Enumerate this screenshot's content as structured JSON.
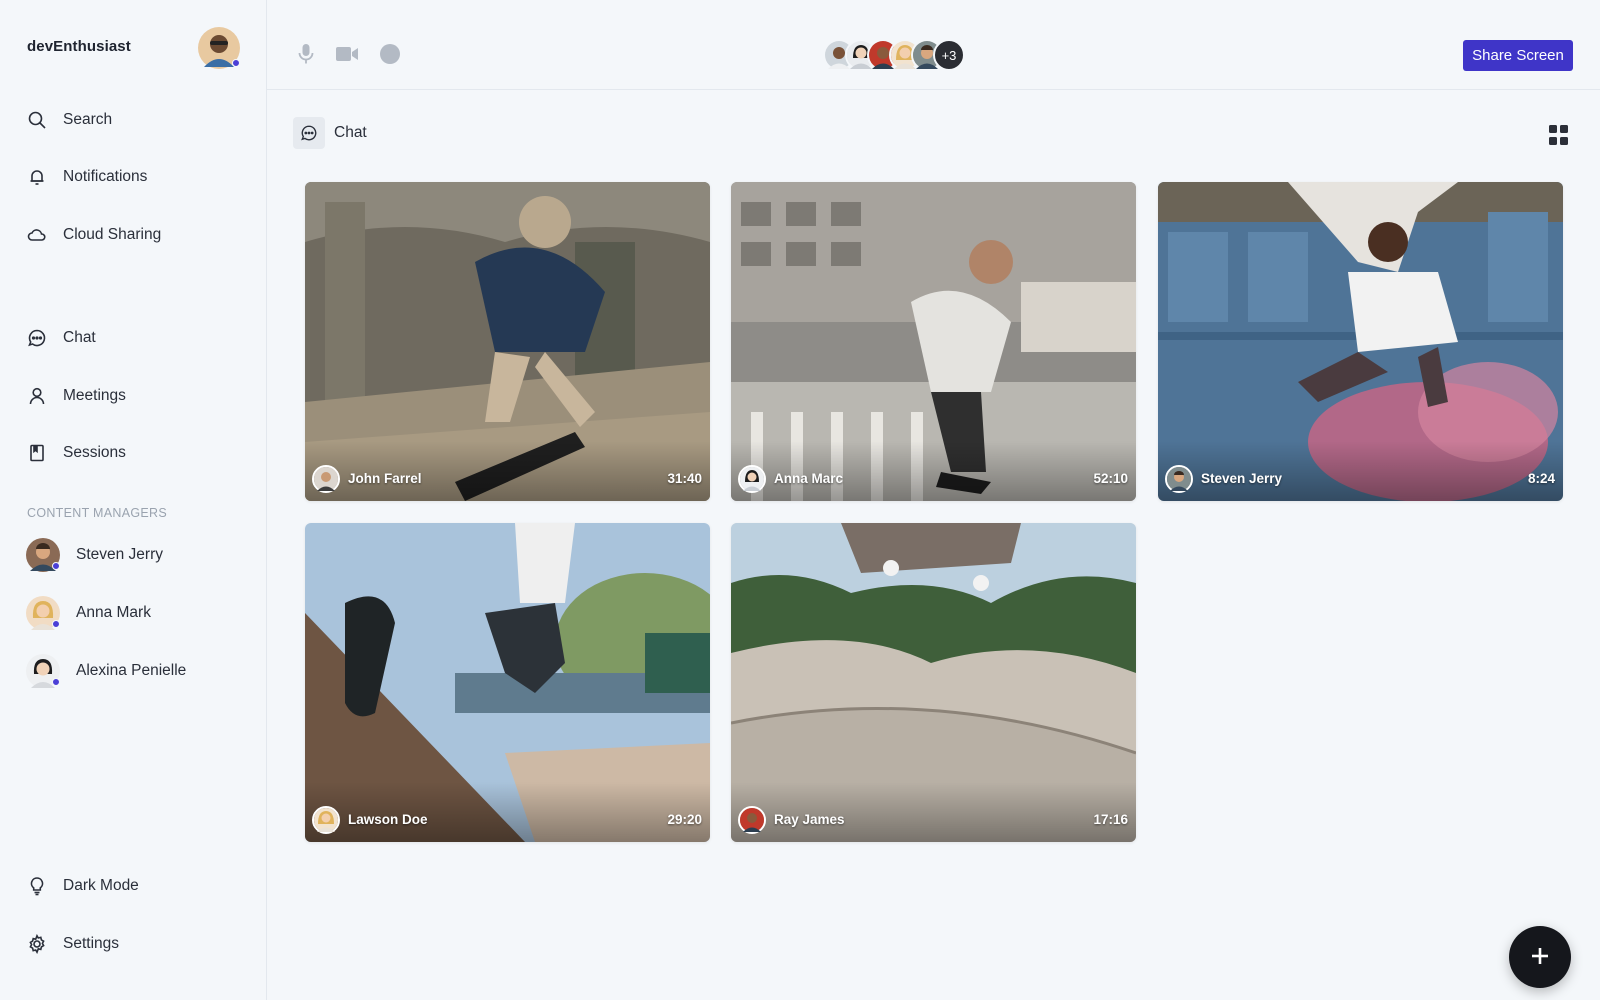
{
  "brand": {
    "name": "devEnthusiast"
  },
  "nav": {
    "search": "Search",
    "notifications": "Notifications",
    "cloud_sharing": "Cloud Sharing",
    "chat": "Chat",
    "meetings": "Meetings",
    "sessions": "Sessions",
    "dark_mode": "Dark Mode",
    "settings": "Settings"
  },
  "content_managers": {
    "title": "CONTENT MANAGERS",
    "people": [
      {
        "name": "Steven Jerry"
      },
      {
        "name": "Anna Mark"
      },
      {
        "name": "Alexina Penielle"
      }
    ]
  },
  "toolbar": {
    "extra_participants": "+3",
    "share_label": "Share Screen"
  },
  "content": {
    "title": "Chat"
  },
  "tiles": [
    {
      "name": "John Farrel",
      "time": "31:40"
    },
    {
      "name": "Anna Marc",
      "time": "52:10"
    },
    {
      "name": "Steven Jerry",
      "time": "8:24"
    },
    {
      "name": "Lawson Doe",
      "time": "29:20"
    },
    {
      "name": "Ray James",
      "time": "17:16"
    }
  ],
  "colors": {
    "accent": "#3f35c8",
    "status_dot": "#4b3fd6",
    "fab": "#15171c"
  },
  "icons": [
    "search-icon",
    "bell-icon",
    "cloud-icon",
    "chat-icon",
    "user-icon",
    "book-icon",
    "bulb-icon",
    "gear-icon",
    "mic-icon",
    "video-icon",
    "record-icon",
    "grid-icon",
    "plus-icon"
  ]
}
